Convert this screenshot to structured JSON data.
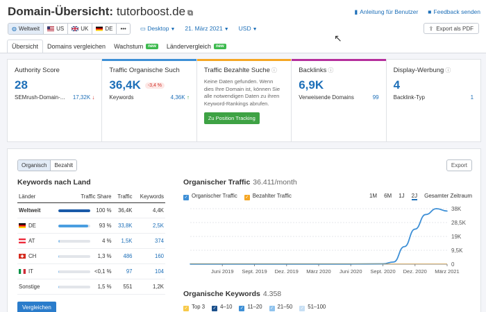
{
  "header": {
    "title_prefix": "Domain-Übersicht:",
    "domain": "tutorboost.de",
    "guide_link": "Anleitung für Benutzer",
    "feedback_link": "Feedback senden"
  },
  "db_selector": {
    "items": [
      {
        "label": "Weltweit",
        "selected": true
      },
      {
        "label": "US"
      },
      {
        "label": "UK"
      },
      {
        "label": "DE"
      },
      {
        "label": "•••"
      }
    ]
  },
  "filters": {
    "device": "Desktop",
    "date": "21. März 2021",
    "currency": "USD"
  },
  "export_pdf": "Export als PDF",
  "tabs": [
    {
      "label": "Übersicht",
      "active": true
    },
    {
      "label": "Domains vergleichen"
    },
    {
      "label": "Wachstum",
      "badge": "new"
    },
    {
      "label": "Ländervergleich",
      "badge": "new"
    }
  ],
  "cards": {
    "authority": {
      "title": "Authority Score",
      "value": "28",
      "sub_label": "SEMrush-Domain-...",
      "sub_value": "17,32K"
    },
    "organic": {
      "title": "Traffic Organische Such",
      "value": "36,4K",
      "change": "-3,4 %",
      "sub_label": "Keywords",
      "sub_value": "4,36K"
    },
    "paid": {
      "title": "Traffic Bezahlte Suche",
      "note": "Keine Daten gefunden. Wenn dies Ihre Domain ist, können Sie alle notwendigen Daten zu ihren Keyword-Rankings abrufen.",
      "button": "Zu Position Tracking"
    },
    "backlinks": {
      "title": "Backlinks",
      "value": "6,9K",
      "sub_label": "Verweisende Domains",
      "sub_value": "99"
    },
    "display": {
      "title": "Display-Werbung",
      "value": "4",
      "sub_label": "Backlink-Typ",
      "sub_value": "1"
    }
  },
  "panel": {
    "toggle": [
      "Organisch",
      "Bezahlt"
    ],
    "export": "Export",
    "kw_by_country_title": "Keywords nach Land",
    "table_headers": [
      "Länder",
      "Traffic Share",
      "Traffic",
      "Keywords"
    ],
    "rows": [
      {
        "country": "Weltweit",
        "share": "100 %",
        "share_pct": 100,
        "traffic": "36,4K",
        "keywords": "4,4K",
        "bold": true
      },
      {
        "country": "DE",
        "share": "93 %",
        "share_pct": 93,
        "traffic": "33,8K",
        "keywords": "2,5K"
      },
      {
        "country": "AT",
        "share": "4 %",
        "share_pct": 4,
        "traffic": "1,5K",
        "keywords": "374"
      },
      {
        "country": "CH",
        "share": "1,3 %",
        "share_pct": 1.3,
        "traffic": "486",
        "keywords": "160"
      },
      {
        "country": "IT",
        "share": "<0,1 %",
        "share_pct": 0.1,
        "traffic": "97",
        "keywords": "104"
      },
      {
        "country": "Sonstige",
        "share": "1,5 %",
        "share_pct": 1.5,
        "traffic": "551",
        "keywords": "1,2K"
      }
    ],
    "compare_button": "Vergleichen",
    "organic_traffic_title": "Organischer Traffic",
    "organic_traffic_value": "36.411/month",
    "legend": [
      "Organischer Traffic",
      "Bezahlter Traffic"
    ],
    "ranges": [
      "1M",
      "6M",
      "1J",
      "2J",
      "Gesamter Zeitraum"
    ],
    "active_range": "2J",
    "organic_keywords_title": "Organische Keywords",
    "organic_keywords_value": "4.358",
    "kw_legend": [
      "Top 3",
      "4–10",
      "11–20",
      "21–50",
      "51–100"
    ]
  },
  "colors": {
    "accent": "#1d6fb8",
    "organic_line": "#3d8fd6",
    "paid": "#f5a623",
    "green": "#3ea244"
  },
  "chart_data": {
    "type": "line",
    "x_ticks": [
      "Juni 2019",
      "Sept. 2019",
      "Dez. 2019",
      "März 2020",
      "Juni 2020",
      "Sept. 2020",
      "Dez. 2020",
      "März 2021"
    ],
    "y_ticks": [
      "38K",
      "28,5K",
      "19K",
      "9,5K",
      "0"
    ],
    "ylim": [
      0,
      38000
    ],
    "series": [
      {
        "name": "Organischer Traffic",
        "x": [
          "2019-03",
          "2019-06",
          "2019-09",
          "2019-12",
          "2020-03",
          "2020-06",
          "2020-09",
          "2020-10",
          "2020-11",
          "2020-12",
          "2021-01",
          "2021-02",
          "2021-03"
        ],
        "values": [
          100,
          100,
          100,
          100,
          100,
          100,
          200,
          1500,
          12000,
          24000,
          34000,
          38000,
          36400
        ]
      }
    ],
    "grid": true
  }
}
